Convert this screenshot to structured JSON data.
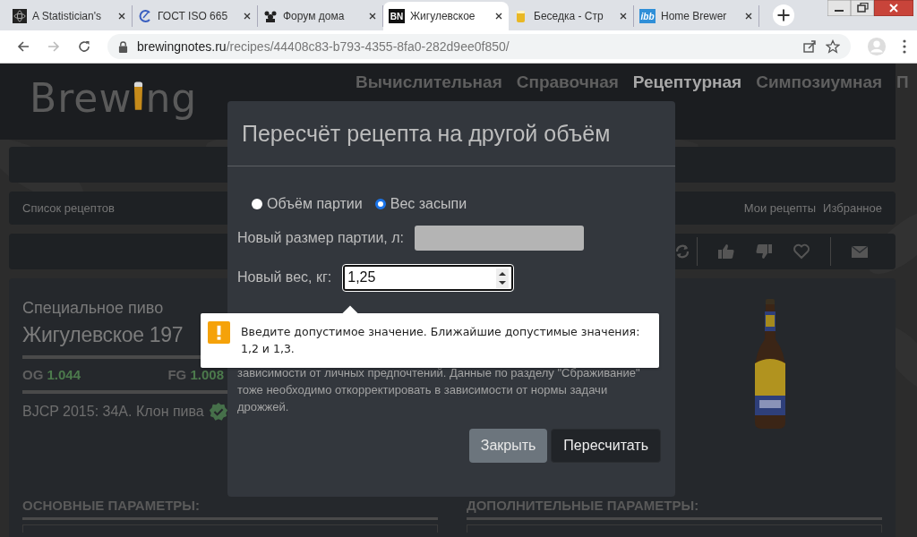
{
  "browser": {
    "tabs": [
      {
        "title": "A Statistician's",
        "kind": "atom",
        "selected": false
      },
      {
        "title": "ГОСТ ISO 665",
        "kind": "swirl",
        "selected": false
      },
      {
        "title": "Форум дома",
        "kind": "figures",
        "selected": false
      },
      {
        "title": "Жигулевское",
        "kind": "letters",
        "favicon_text": "BN",
        "selected": true
      },
      {
        "title": "Беседка - Стр",
        "kind": "mug",
        "selected": false
      },
      {
        "title": "Home Brewer",
        "kind": "letters",
        "favicon_text": "ibb",
        "selected": false
      }
    ],
    "url": {
      "host": "brewingnotes.ru",
      "path": "/recipes/44408c83-b793-4355-8fa0-282d9ee0f850/"
    }
  },
  "site": {
    "logo": {
      "before": "Brew",
      "after": "ng"
    },
    "nav": [
      {
        "label": "Вычислительная",
        "selected": false
      },
      {
        "label": "Справочная",
        "selected": false
      },
      {
        "label": "Рецептурная",
        "selected": true
      },
      {
        "label": "Симпозиумная",
        "selected": false
      },
      {
        "label": "П",
        "selected": false
      }
    ],
    "breadcrumb": "Список рецептов",
    "links": [
      "Мои рецепты",
      "Избранное"
    ],
    "recipe": {
      "style": "Специальное пиво",
      "name": "Жигулевское 197",
      "og_label": "OG",
      "og": "1.044",
      "fg_label": "FG",
      "fg": "1.008",
      "bjcp": "BJCP 2015: 34A. Клон пива",
      "verified": true
    },
    "sections": [
      "ОСНОВНЫЕ ПАРАМЕТРЫ:",
      "ДОПОЛНИТЕЛЬНЫЕ ПАРАМЕТРЫ:"
    ]
  },
  "dialog": {
    "title": "Пересчёт рецепта на другой объём",
    "modes": [
      {
        "label": "Объём партии",
        "selected": false
      },
      {
        "label": "Вес засыпи",
        "selected": true
      }
    ],
    "fields": [
      {
        "label": "Новый размер партии, л:",
        "disabled": true,
        "kind": "text"
      },
      {
        "label": "Новый вес, кг:",
        "value": "1,25",
        "disabled": false,
        "kind": "number"
      }
    ],
    "note_lines": [
      "зависимости от личных предпочтений. Данные по разделу \"Сбраживание\"",
      "тоже необходимо откорректировать в зависимости от нормы задачи",
      "дрожжей."
    ],
    "buttons": [
      {
        "label": "Закрыть",
        "kind": "secondary"
      },
      {
        "label": "Пересчитать",
        "kind": "primary"
      }
    ]
  },
  "tooltip": {
    "text": "Введите допустимое значение. Ближайшие допустимые значения: 1,2 и 1,3."
  }
}
